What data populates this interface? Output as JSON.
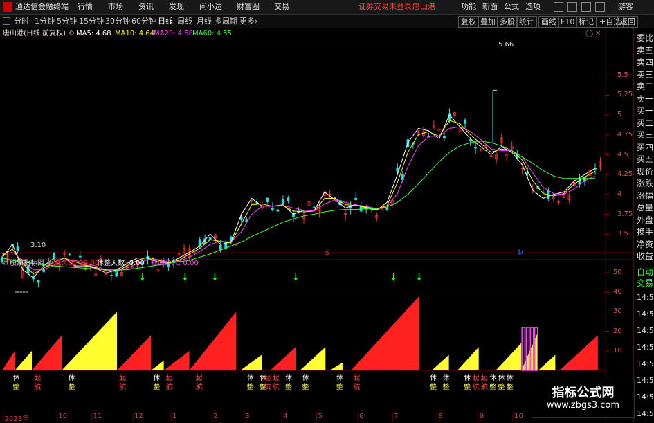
{
  "titlebar": {
    "app_name": "通达信金融终端",
    "menus": [
      "行情",
      "市场",
      "资讯",
      "发现",
      "问小达",
      "财富圈",
      "交易"
    ],
    "notice": "证券交易未登录",
    "stock": "唐山港",
    "right_menus": [
      "功能",
      "新面",
      "公式",
      "选项"
    ],
    "guest": "游客"
  },
  "toolbar": {
    "periods": [
      "分时",
      "1分钟",
      "5分钟",
      "15分钟",
      "30分钟",
      "60分钟",
      "日线",
      "周线",
      "月线",
      "多周期",
      "更多"
    ],
    "active_period": "日线",
    "buttons": [
      "复权",
      "叠加",
      "多股",
      "统计",
      "画线",
      "F10",
      "标记",
      "+自选",
      "返回"
    ]
  },
  "right_panel": {
    "items": [
      "委比",
      "卖五",
      "卖四",
      "卖三",
      "卖二",
      "卖一",
      "买一",
      "买二",
      "买三",
      "买四",
      "买五",
      "现价",
      "涨跌",
      "涨幅",
      "总量",
      "外盘",
      "换手",
      "净资",
      "收益"
    ],
    "lower_items": [
      "自动",
      "交易"
    ],
    "times": [
      "14:50",
      "14:50",
      "14:50",
      "14:50",
      "14:50",
      "14:50",
      "14:50",
      "14:50"
    ]
  },
  "main_chart": {
    "title": "唐山港(日线 前复权)",
    "ma": [
      {
        "label": "MA5: 4.68",
        "color": "#ffffff"
      },
      {
        "label": "MA10: 4.64",
        "color": "#ffff00"
      },
      {
        "label": "MA20: 4.58",
        "color": "#ff40ff"
      },
      {
        "label": "MA60: 4.55",
        "color": "#40ff40"
      }
    ],
    "high_label": "5.66",
    "low_label": "3.10",
    "markers": [
      "S",
      "财"
    ]
  },
  "indicator": {
    "name": "股票指标网",
    "legend": [
      {
        "label": "起航天数: 19.00",
        "color": "#ff3030"
      },
      {
        "label": "休整天数: 0.00",
        "color": "#ffffff"
      },
      {
        "label": "抄底介入: 0.00",
        "color": "#ff40ff"
      }
    ]
  },
  "labels": {
    "rest": "休",
    "rest2": "整",
    "sail": "起",
    "sail2": "航"
  },
  "chart_data": [
    {
      "type": "candlestick",
      "title": "唐山港(日线 前复权)",
      "y_ticks": [
        3.5,
        3.75,
        4.0,
        4.25,
        4.5,
        4.75,
        5.0,
        5.25,
        5.5
      ],
      "ylim": [
        3.05,
        5.75
      ],
      "series": [
        {
          "name": "MA5",
          "color": "#ffffff",
          "values": [
            3.55,
            3.72,
            3.4,
            3.3,
            3.45,
            3.55,
            3.55,
            3.45,
            3.45,
            3.42,
            3.36,
            3.4,
            3.48,
            3.55,
            3.55,
            3.5,
            3.48,
            3.55,
            3.62,
            3.7,
            3.85,
            3.72,
            3.75,
            4.1,
            4.3,
            4.2,
            4.2,
            4.22,
            4.1,
            4.15,
            4.15,
            4.38,
            4.28,
            4.18,
            4.22,
            4.18,
            4.15,
            4.25,
            4.6,
            5.0,
            5.18,
            5.15,
            5.05,
            5.35,
            5.2,
            5.05,
            4.95,
            4.85,
            4.95,
            4.88,
            4.72,
            4.4,
            4.3,
            4.35,
            4.38,
            4.52,
            4.6,
            4.68
          ]
        },
        {
          "name": "MA10",
          "color": "#ffff00",
          "values": [
            3.58,
            3.66,
            3.48,
            3.35,
            3.42,
            3.5,
            3.55,
            3.5,
            3.46,
            3.43,
            3.39,
            3.38,
            3.45,
            3.52,
            3.56,
            3.52,
            3.49,
            3.52,
            3.6,
            3.67,
            3.78,
            3.76,
            3.74,
            3.98,
            4.22,
            4.23,
            4.2,
            4.21,
            4.14,
            4.13,
            4.14,
            4.3,
            4.3,
            4.22,
            4.21,
            4.19,
            4.16,
            4.21,
            4.5,
            4.88,
            5.1,
            5.14,
            5.08,
            5.28,
            5.24,
            5.1,
            4.99,
            4.88,
            4.92,
            4.9,
            4.78,
            4.52,
            4.36,
            4.33,
            4.36,
            4.48,
            4.57,
            4.64
          ]
        },
        {
          "name": "MA20",
          "color": "#ff40ff",
          "values": [
            3.6,
            3.62,
            3.52,
            3.4,
            3.4,
            3.46,
            3.52,
            3.52,
            3.48,
            3.45,
            3.4,
            3.38,
            3.42,
            3.48,
            3.53,
            3.53,
            3.5,
            3.51,
            3.56,
            3.63,
            3.72,
            3.76,
            3.75,
            3.88,
            4.1,
            4.2,
            4.2,
            4.21,
            4.18,
            4.15,
            4.14,
            4.23,
            4.28,
            4.25,
            4.22,
            4.2,
            4.17,
            4.19,
            4.36,
            4.7,
            4.96,
            5.08,
            5.08,
            5.18,
            5.2,
            5.14,
            5.04,
            4.92,
            4.9,
            4.9,
            4.82,
            4.62,
            4.44,
            4.36,
            4.35,
            4.42,
            4.52,
            4.58
          ]
        },
        {
          "name": "MA60",
          "color": "#40ff40",
          "values": [
            3.55,
            3.52,
            3.5,
            3.48,
            3.46,
            3.45,
            3.44,
            3.43,
            3.42,
            3.41,
            3.4,
            3.4,
            3.4,
            3.42,
            3.44,
            3.46,
            3.48,
            3.5,
            3.52,
            3.56,
            3.6,
            3.65,
            3.7,
            3.75,
            3.82,
            3.88,
            3.94,
            4.0,
            4.04,
            4.08,
            4.1,
            4.13,
            4.15,
            4.16,
            4.16,
            4.17,
            4.17,
            4.19,
            4.25,
            4.35,
            4.48,
            4.62,
            4.76,
            4.88,
            4.96,
            5.0,
            5.02,
            5.0,
            4.96,
            4.9,
            4.82,
            4.74,
            4.65,
            4.58,
            4.55,
            4.55,
            4.55,
            4.55
          ]
        }
      ]
    },
    {
      "type": "bar",
      "title": "股票指标网",
      "y_ticks": [
        10,
        20,
        30,
        40,
        50
      ],
      "ylim": [
        0,
        55
      ],
      "ramps": [
        {
          "start": 0,
          "len": 3,
          "peak": 10,
          "color": "red"
        },
        {
          "start": 3,
          "len": 4,
          "peak": 10,
          "color": "yellow"
        },
        {
          "start": 7,
          "len": 7,
          "peak": 18,
          "color": "red"
        },
        {
          "start": 14,
          "len": 13,
          "peak": 30,
          "color": "yellow"
        },
        {
          "start": 27,
          "len": 8,
          "peak": 18,
          "color": "red"
        },
        {
          "start": 35,
          "len": 3,
          "peak": 5,
          "color": "yellow"
        },
        {
          "start": 38,
          "len": 6,
          "peak": 10,
          "color": "red"
        },
        {
          "start": 44,
          "len": 11,
          "peak": 30,
          "color": "red"
        },
        {
          "start": 56,
          "len": 5,
          "peak": 8,
          "color": "yellow"
        },
        {
          "start": 63,
          "len": 6,
          "peak": 12,
          "color": "red"
        },
        {
          "start": 70,
          "len": 6,
          "peak": 12,
          "color": "yellow"
        },
        {
          "start": 77,
          "len": 3,
          "peak": 4,
          "color": "yellow"
        },
        {
          "start": 82,
          "len": 16,
          "peak": 38,
          "color": "red"
        },
        {
          "start": 101,
          "len": 4,
          "peak": 8,
          "color": "yellow"
        },
        {
          "start": 107,
          "len": 5,
          "peak": 12,
          "color": "yellow"
        },
        {
          "start": 116,
          "len": 6,
          "peak": 14,
          "color": "yellow"
        },
        {
          "start": 122,
          "len": 4,
          "peak": 20,
          "color": "yellow"
        },
        {
          "start": 126,
          "len": 4,
          "peak": 8,
          "color": "yellow"
        },
        {
          "start": 131,
          "len": 9,
          "peak": 18,
          "color": "red"
        }
      ],
      "magenta_bars": [
        122,
        123,
        124,
        125
      ],
      "buy_arrows": [
        33,
        43,
        50,
        69,
        92,
        98
      ],
      "rest_labels": [
        3,
        16,
        36,
        58,
        61,
        67,
        71,
        79,
        101,
        104,
        109,
        115,
        117,
        119
      ],
      "sail_labels": [
        8,
        28,
        39,
        46,
        62,
        64,
        83,
        111,
        113
      ]
    }
  ],
  "x_axis": {
    "ticks": [
      {
        "label": "2023年",
        "pos": 0.005
      },
      {
        "label": "10",
        "pos": 0.09
      },
      {
        "label": "11",
        "pos": 0.145
      },
      {
        "label": "12",
        "pos": 0.21
      },
      {
        "label": "1",
        "pos": 0.27
      },
      {
        "label": "2",
        "pos": 0.335
      },
      {
        "label": "3",
        "pos": 0.385
      },
      {
        "label": "4",
        "pos": 0.445
      },
      {
        "label": "5",
        "pos": 0.5
      },
      {
        "label": "6",
        "pos": 0.565
      },
      {
        "label": "7",
        "pos": 0.62
      },
      {
        "label": "8",
        "pos": 0.69
      },
      {
        "label": "9",
        "pos": 0.755
      },
      {
        "label": "10",
        "pos": 0.81
      }
    ]
  },
  "watermark": {
    "title": "指标公式网",
    "url": "www.zbgs3.com"
  }
}
